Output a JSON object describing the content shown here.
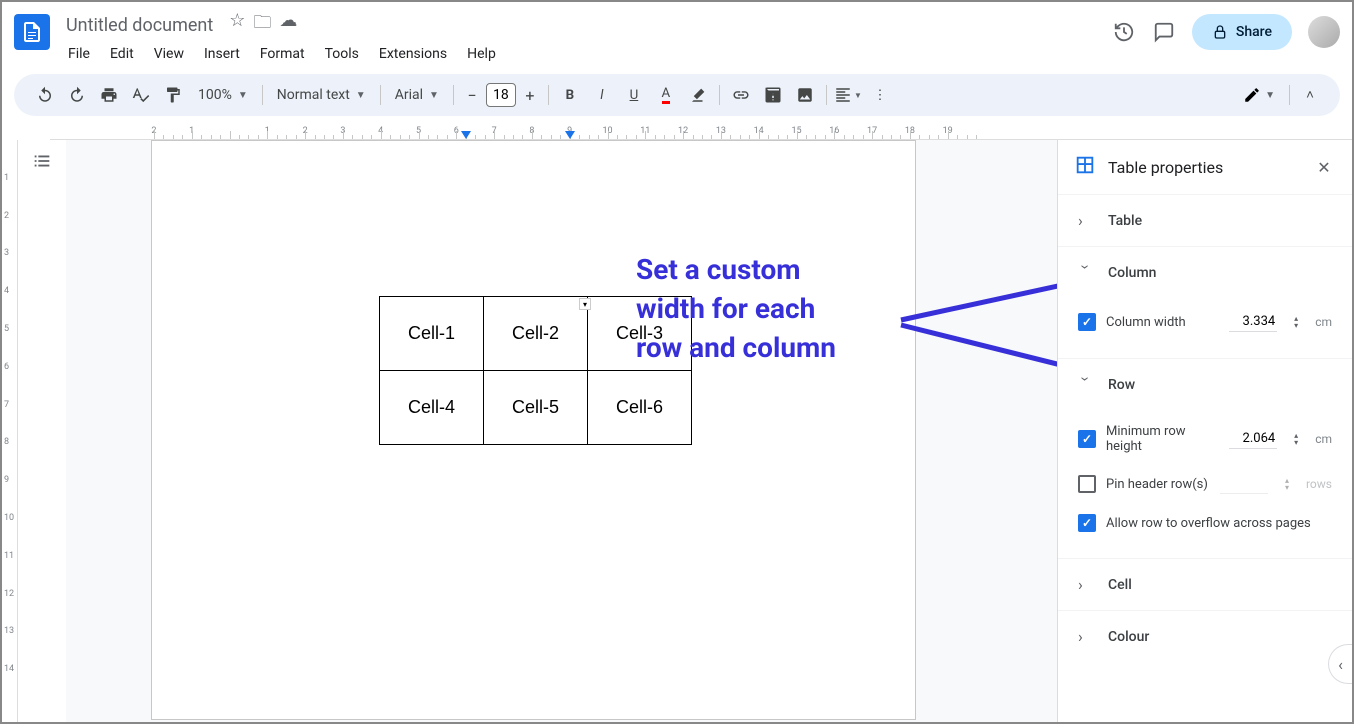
{
  "header": {
    "title": "Untitled document",
    "menus": [
      "File",
      "Edit",
      "View",
      "Insert",
      "Format",
      "Tools",
      "Extensions",
      "Help"
    ],
    "share_label": "Share"
  },
  "toolbar": {
    "zoom": "100%",
    "style": "Normal text",
    "font": "Arial",
    "font_size": "18"
  },
  "ruler": {
    "h_numbers": [
      2,
      1,
      1,
      2,
      3,
      4,
      5,
      6,
      7,
      8,
      9,
      10,
      11,
      12,
      13,
      14,
      15,
      16,
      17,
      18,
      19
    ],
    "v_numbers": [
      1,
      2,
      3,
      4,
      5,
      6,
      7,
      8,
      9,
      10,
      11,
      12,
      13,
      14
    ]
  },
  "table": {
    "cells": [
      [
        "Cell-1",
        "Cell-2",
        "Cell-3"
      ],
      [
        "Cell-4",
        "Cell-5",
        "Cell-6"
      ]
    ]
  },
  "annotation": {
    "line1": "Set a custom",
    "line2": "width for each",
    "line3": "row and column"
  },
  "sidebar": {
    "title": "Table properties",
    "sections": {
      "table": "Table",
      "column": "Column",
      "row": "Row",
      "cell": "Cell",
      "colour": "Colour"
    },
    "column": {
      "width_label": "Column width",
      "width_value": "3.334",
      "width_unit": "cm"
    },
    "row": {
      "min_height_label": "Minimum row height",
      "min_height_value": "2.064",
      "min_height_unit": "cm",
      "pin_header_label": "Pin header row(s)",
      "pin_header_unit": "rows",
      "overflow_label": "Allow row to overflow across pages"
    }
  }
}
